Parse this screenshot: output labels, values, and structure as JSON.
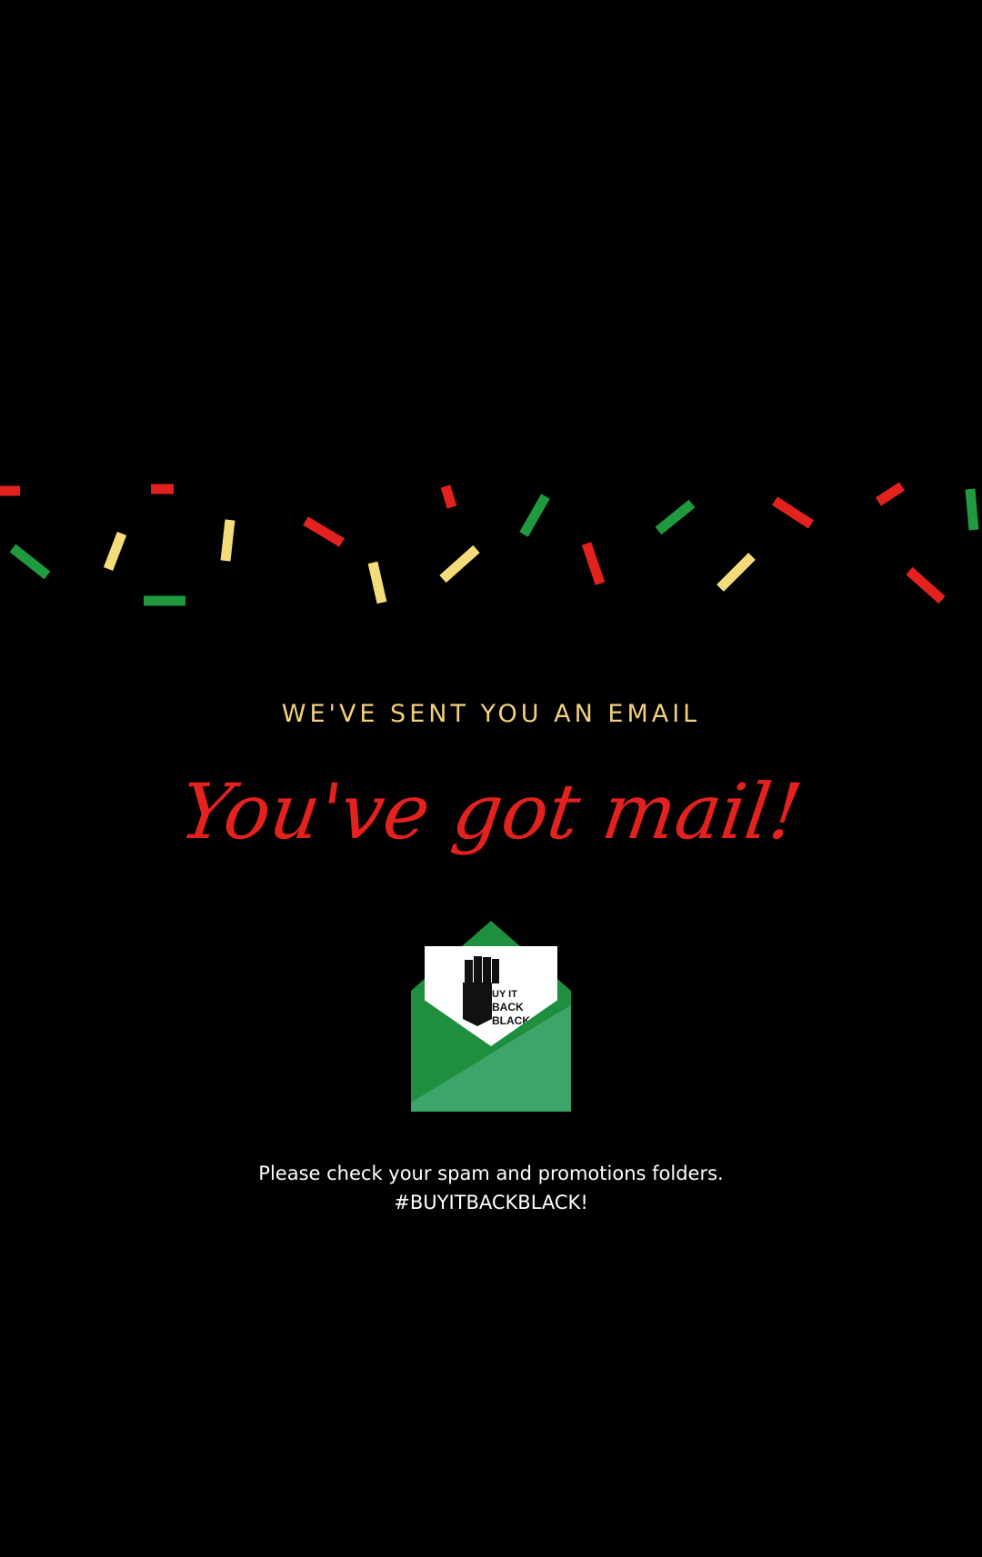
{
  "message": {
    "subtitle": "WE'VE SENT YOU AN EMAIL",
    "headline": "You've got mail!",
    "instructions": "Please check your spam and promotions folders.",
    "hashtag": "#BUYITBACKBLACK!"
  },
  "logo": {
    "lines": [
      "UY IT",
      "BACK",
      "BLACK"
    ]
  },
  "colors": {
    "background": "#000000",
    "subtitle": "#f3d07a",
    "headline": "#e3221f",
    "confetti_red": "#e3221f",
    "confetti_green": "#1f9a3e",
    "confetti_yellow": "#f5dc7a",
    "envelope_dark": "#1e8f3e",
    "envelope_light": "#3da569"
  },
  "icons": {
    "envelope": "open-envelope-icon",
    "logo": "raised-fist-logo"
  }
}
